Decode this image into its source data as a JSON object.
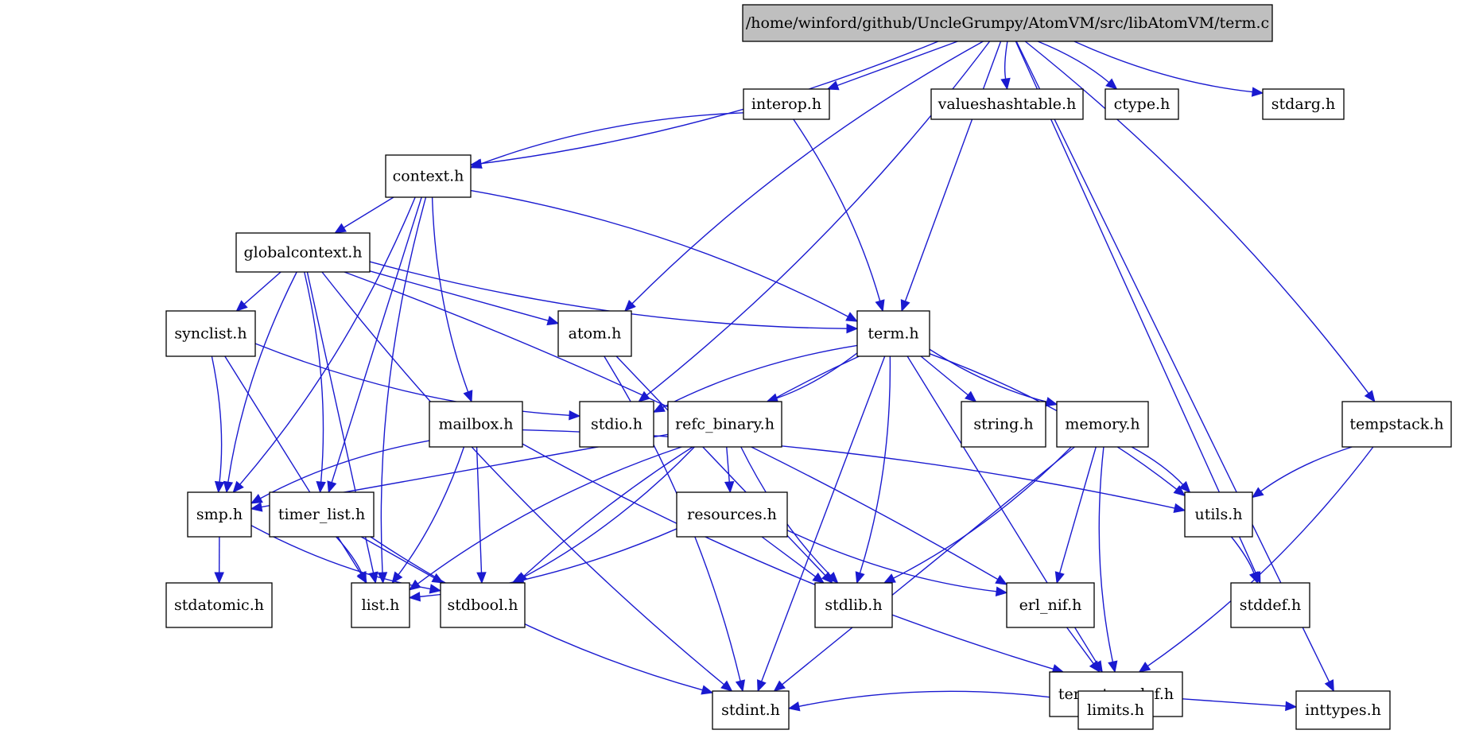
{
  "diagram": {
    "type": "include-dependency-graph",
    "colors": {
      "root_fill": "#bfbfbf",
      "node_fill": "#ffffff",
      "edge": "#1a1ad0",
      "border": "#000000"
    },
    "root": "/home/winford/github/UncleGrumpy/AtomVM/src/libAtomVM/term.c",
    "nodes": [
      {
        "id": "root",
        "label": "/home/winford/github/UncleGrumpy/AtomVM/src/libAtomVM/term.c",
        "root": true
      },
      {
        "id": "interop",
        "label": "interop.h"
      },
      {
        "id": "valueshashtable",
        "label": "valueshashtable.h"
      },
      {
        "id": "ctype",
        "label": "ctype.h"
      },
      {
        "id": "stdarg",
        "label": "stdarg.h"
      },
      {
        "id": "context",
        "label": "context.h"
      },
      {
        "id": "globalcontext",
        "label": "globalcontext.h"
      },
      {
        "id": "synclist",
        "label": "synclist.h"
      },
      {
        "id": "atom",
        "label": "atom.h"
      },
      {
        "id": "term",
        "label": "term.h"
      },
      {
        "id": "mailbox",
        "label": "mailbox.h"
      },
      {
        "id": "stdio",
        "label": "stdio.h"
      },
      {
        "id": "refc_binary",
        "label": "refc_binary.h"
      },
      {
        "id": "string",
        "label": "string.h"
      },
      {
        "id": "memory",
        "label": "memory.h"
      },
      {
        "id": "tempstack",
        "label": "tempstack.h"
      },
      {
        "id": "smp",
        "label": "smp.h"
      },
      {
        "id": "timer_list",
        "label": "timer_list.h"
      },
      {
        "id": "resources",
        "label": "resources.h"
      },
      {
        "id": "utils",
        "label": "utils.h"
      },
      {
        "id": "stdatomic",
        "label": "stdatomic.h"
      },
      {
        "id": "list",
        "label": "list.h"
      },
      {
        "id": "stdbool",
        "label": "stdbool.h"
      },
      {
        "id": "stdlib",
        "label": "stdlib.h"
      },
      {
        "id": "erl_nif",
        "label": "erl_nif.h"
      },
      {
        "id": "stddef",
        "label": "stddef.h"
      },
      {
        "id": "term_typedef",
        "label": "term_typedef.h"
      },
      {
        "id": "stdint",
        "label": "stdint.h"
      },
      {
        "id": "limits",
        "label": "limits.h"
      },
      {
        "id": "inttypes",
        "label": "inttypes.h"
      }
    ],
    "edges": [
      [
        "root",
        "context"
      ],
      [
        "root",
        "interop"
      ],
      [
        "root",
        "atom"
      ],
      [
        "root",
        "stdio"
      ],
      [
        "root",
        "term"
      ],
      [
        "root",
        "valueshashtable"
      ],
      [
        "root",
        "ctype"
      ],
      [
        "root",
        "stddef"
      ],
      [
        "root",
        "stdarg"
      ],
      [
        "root",
        "tempstack"
      ],
      [
        "root",
        "inttypes"
      ],
      [
        "interop",
        "context"
      ],
      [
        "interop",
        "term"
      ],
      [
        "context",
        "globalcontext"
      ],
      [
        "context",
        "list"
      ],
      [
        "context",
        "smp"
      ],
      [
        "context",
        "timer_list"
      ],
      [
        "context",
        "mailbox"
      ],
      [
        "context",
        "term"
      ],
      [
        "globalcontext",
        "synclist"
      ],
      [
        "globalcontext",
        "smp"
      ],
      [
        "globalcontext",
        "timer_list"
      ],
      [
        "globalcontext",
        "atom"
      ],
      [
        "globalcontext",
        "term"
      ],
      [
        "globalcontext",
        "erl_nif"
      ],
      [
        "globalcontext",
        "list"
      ],
      [
        "globalcontext",
        "stdint"
      ],
      [
        "synclist",
        "smp"
      ],
      [
        "synclist",
        "list"
      ],
      [
        "synclist",
        "stdio"
      ],
      [
        "atom",
        "stdint"
      ],
      [
        "atom",
        "stdlib"
      ],
      [
        "term",
        "stdio"
      ],
      [
        "term",
        "refc_binary"
      ],
      [
        "term",
        "string"
      ],
      [
        "term",
        "memory"
      ],
      [
        "term",
        "utils"
      ],
      [
        "term",
        "term_typedef"
      ],
      [
        "term",
        "stdbool"
      ],
      [
        "term",
        "stdlib"
      ],
      [
        "term",
        "stdint"
      ],
      [
        "mailbox",
        "smp"
      ],
      [
        "mailbox",
        "list"
      ],
      [
        "mailbox",
        "stdbool"
      ],
      [
        "mailbox",
        "term_typedef"
      ],
      [
        "mailbox",
        "utils"
      ],
      [
        "refc_binary",
        "smp"
      ],
      [
        "refc_binary",
        "list"
      ],
      [
        "refc_binary",
        "stdbool"
      ],
      [
        "refc_binary",
        "resources"
      ],
      [
        "refc_binary",
        "stdlib"
      ],
      [
        "memory",
        "utils"
      ],
      [
        "memory",
        "erl_nif"
      ],
      [
        "memory",
        "term_typedef"
      ],
      [
        "memory",
        "stdlib"
      ],
      [
        "memory",
        "stdint"
      ],
      [
        "tempstack",
        "utils"
      ],
      [
        "tempstack",
        "term_typedef"
      ],
      [
        "smp",
        "stdatomic"
      ],
      [
        "smp",
        "stdbool"
      ],
      [
        "timer_list",
        "list"
      ],
      [
        "timer_list",
        "stdbool"
      ],
      [
        "timer_list",
        "stdint"
      ],
      [
        "resources",
        "list"
      ],
      [
        "resources",
        "stdlib"
      ],
      [
        "resources",
        "erl_nif"
      ],
      [
        "utils",
        "stddef"
      ],
      [
        "erl_nif",
        "term_typedef"
      ],
      [
        "term_typedef",
        "stdint"
      ],
      [
        "term_typedef",
        "limits"
      ],
      [
        "term_typedef",
        "inttypes"
      ]
    ]
  }
}
